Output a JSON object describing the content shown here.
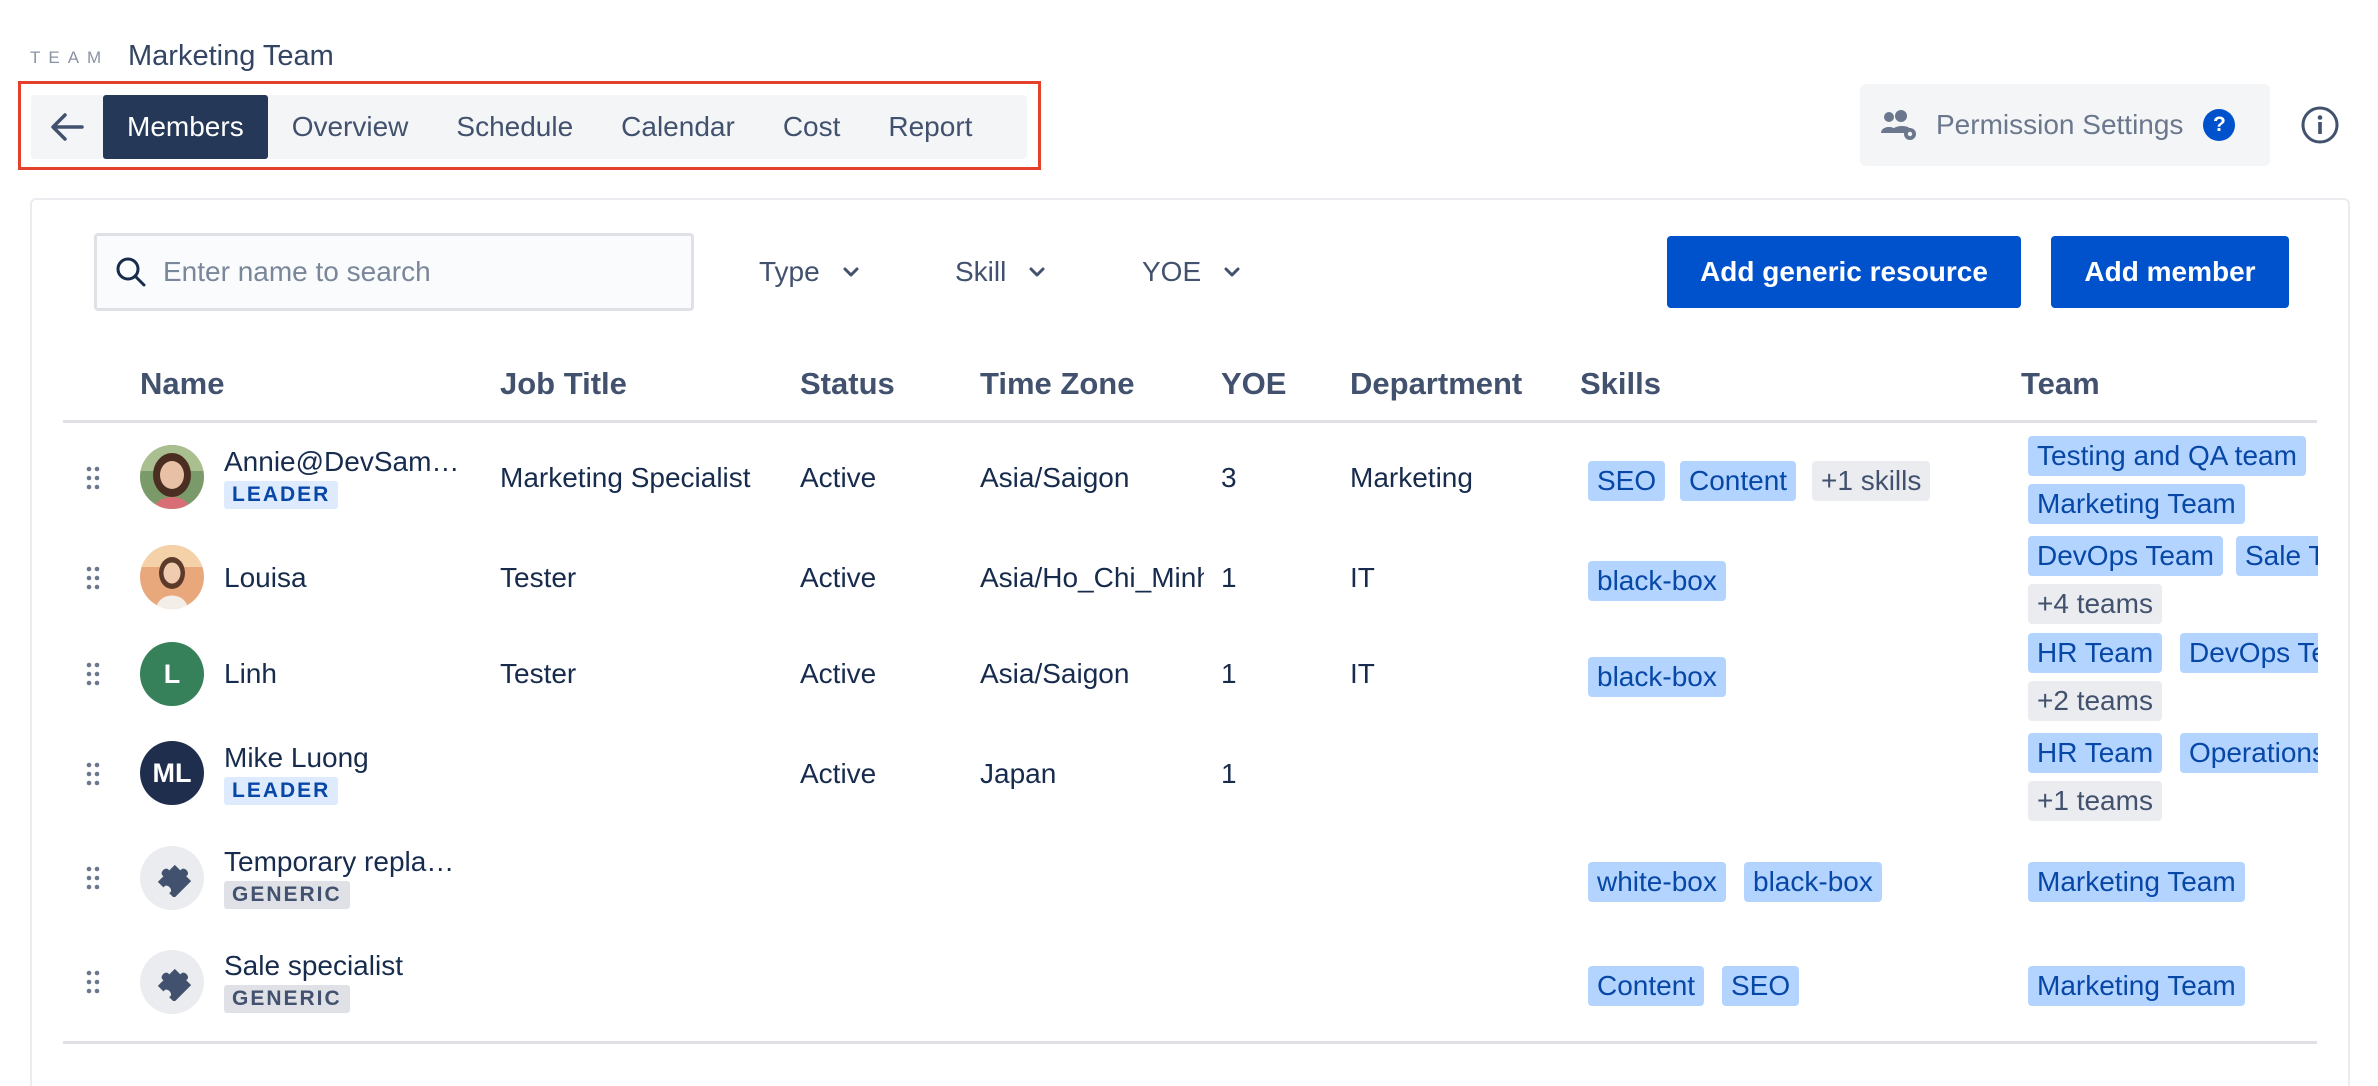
{
  "header": {
    "eyebrow": "TEAM",
    "team_name": "Marketing Team"
  },
  "tabs": [
    "Members",
    "Overview",
    "Schedule",
    "Calendar",
    "Cost",
    "Report"
  ],
  "active_tab": "Members",
  "toolbar": {
    "permission_label": "Permission Settings",
    "help_glyph": "?"
  },
  "search": {
    "placeholder": "Enter name to search",
    "value": ""
  },
  "filters": [
    "Type",
    "Skill",
    "YOE"
  ],
  "actions": {
    "add_generic": "Add generic resource",
    "add_member": "Add member"
  },
  "columns": [
    "Name",
    "Job Title",
    "Status",
    "Time Zone",
    "YOE",
    "Department",
    "Skills",
    "Team"
  ],
  "rows": [
    {
      "name": "Annie@DevSam…",
      "badge": "LEADER",
      "job_title": "Marketing Specialist",
      "status": "Active",
      "time_zone": "Asia/Saigon",
      "yoe": "3",
      "department": "Marketing",
      "skills": [
        "SEO",
        "Content"
      ],
      "skills_more": "+1 skills",
      "teams": [
        "Testing and QA team",
        "Marketing Team"
      ],
      "teams_more": ""
    },
    {
      "name": "Louisa",
      "badge": "",
      "job_title": "Tester",
      "status": "Active",
      "time_zone": "Asia/Ho_Chi_Minh",
      "yoe": "1",
      "department": "IT",
      "skills": [
        "black-box"
      ],
      "skills_more": "",
      "teams": [
        "DevOps Team",
        "Sale Team"
      ],
      "teams_more": "+4 teams"
    },
    {
      "name": "Linh",
      "badge": "",
      "avatar_initials": "L",
      "job_title": "Tester",
      "status": "Active",
      "time_zone": "Asia/Saigon",
      "yoe": "1",
      "department": "IT",
      "skills": [
        "black-box"
      ],
      "skills_more": "",
      "teams": [
        "HR Team",
        "DevOps Team"
      ],
      "teams_more": "+2 teams"
    },
    {
      "name": "Mike Luong",
      "badge": "LEADER",
      "avatar_initials": "ML",
      "job_title": "",
      "status": "Active",
      "time_zone": "Japan",
      "yoe": "1",
      "department": "",
      "skills": [],
      "skills_more": "",
      "teams": [
        "HR Team",
        "Operations Team"
      ],
      "teams_more": "+1 teams"
    },
    {
      "name": "Temporary repla…",
      "badge": "GENERIC",
      "job_title": "",
      "status": "",
      "time_zone": "",
      "yoe": "",
      "department": "",
      "skills": [
        "white-box",
        "black-box"
      ],
      "skills_more": "",
      "teams": [
        "Marketing Team"
      ],
      "teams_more": ""
    },
    {
      "name": "Sale specialist",
      "badge": "GENERIC",
      "job_title": "",
      "status": "",
      "time_zone": "",
      "yoe": "",
      "department": "",
      "skills": [
        "Content",
        "SEO"
      ],
      "skills_more": "",
      "teams": [
        "Marketing Team"
      ],
      "teams_more": ""
    }
  ],
  "colors": {
    "primary": "#0052cc",
    "active_tab": "#253858",
    "chip_blue": "#b3d4ff",
    "highlight_border": "#e3412b",
    "linh_avatar": "#36805a",
    "mike_avatar": "#1f2e4d"
  }
}
